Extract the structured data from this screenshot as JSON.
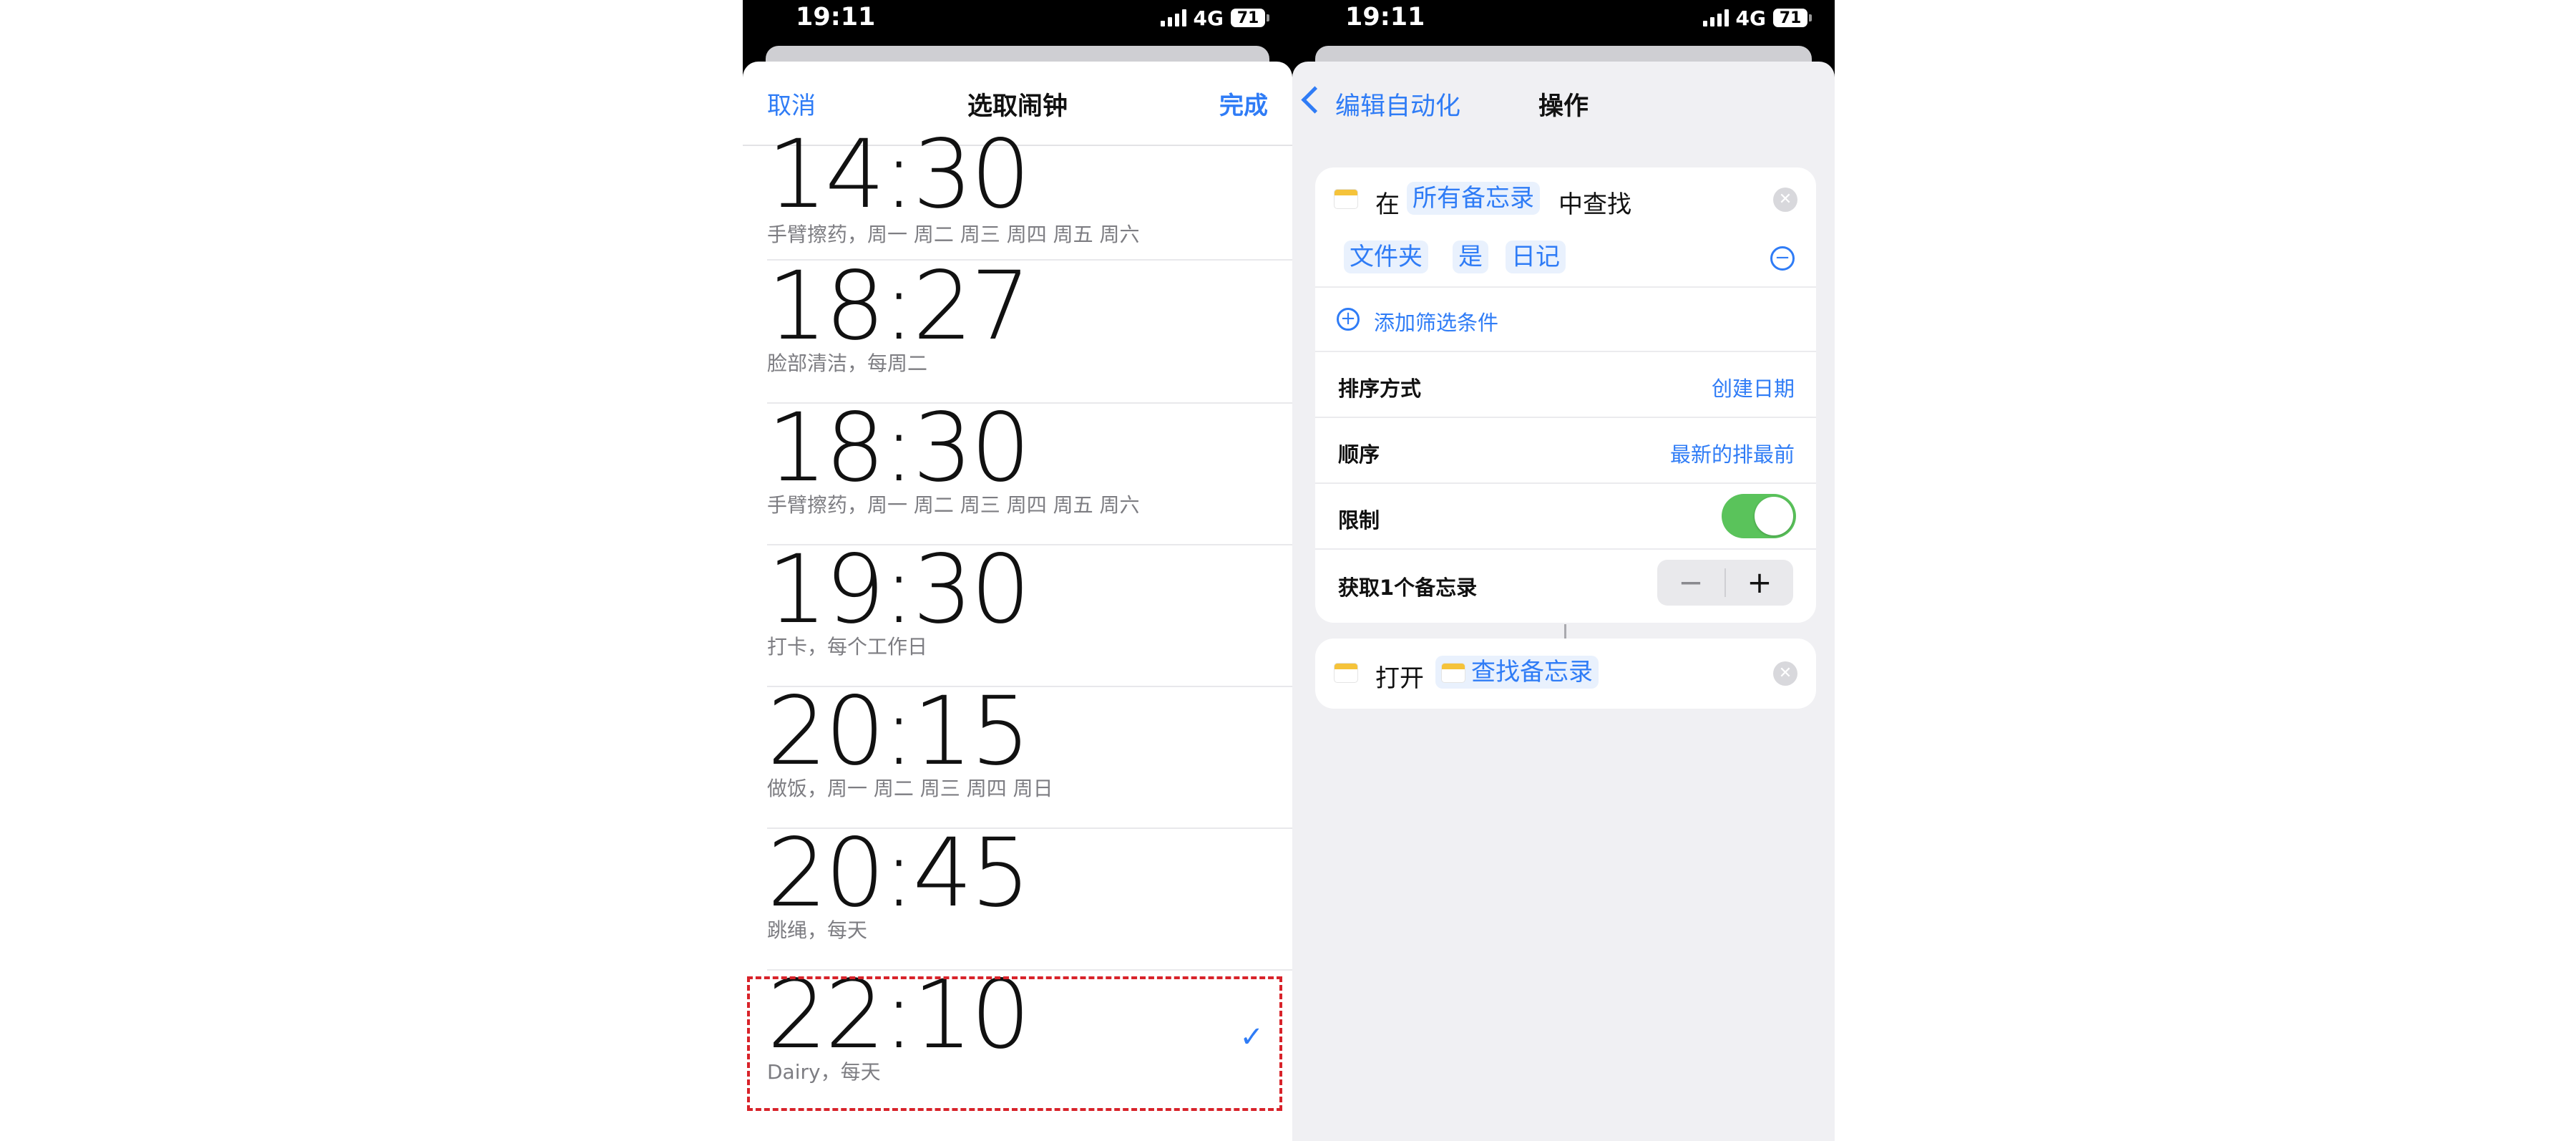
{
  "left": {
    "status": {
      "time": "19:11",
      "network": "4G",
      "battery": "71"
    },
    "nav": {
      "cancel": "取消",
      "title": "选取闹钟",
      "done": "完成"
    },
    "alarms": [
      {
        "time": "14:30",
        "label": "手臂擦药，周一 周二 周三 周四 周五 周六"
      },
      {
        "time": "18:27",
        "label": "脸部清洁，每周二"
      },
      {
        "time": "18:30",
        "label": "手臂擦药，周一 周二 周三 周四 周五 周六"
      },
      {
        "time": "19:30",
        "label": "打卡，每个工作日"
      },
      {
        "time": "20:15",
        "label": "做饭，周一 周二 周三 周四 周日"
      },
      {
        "time": "20:45",
        "label": "跳绳，每天"
      },
      {
        "time": "22:10",
        "label": "Dairy，每天",
        "selected": true
      }
    ],
    "checkmark": "✓"
  },
  "right": {
    "status": {
      "time": "19:11",
      "network": "4G",
      "battery": "71"
    },
    "nav": {
      "back": "编辑自动化",
      "title": "操作"
    },
    "find_action": {
      "prefix": "在",
      "source": "所有备忘录",
      "suffix": "中查找",
      "filter": {
        "field": "文件夹",
        "op": "是",
        "value": "日记"
      },
      "add_filter": "添加筛选条件",
      "sort_label": "排序方式",
      "sort_value": "创建日期",
      "order_label": "顺序",
      "order_value": "最新的排最前",
      "limit_label": "限制",
      "limit_enabled": true,
      "get_label": "获取1个备忘录",
      "stepper_minus": "−",
      "stepper_plus": "+"
    },
    "open_action": {
      "verb": "打开",
      "target": "查找备忘录"
    },
    "icons": {
      "note": "notes-app-icon",
      "clear": "clear-icon",
      "remove_filter": "minus-circle-icon",
      "add": "plus-circle-icon"
    },
    "colors": {
      "accent": "#2f7cf6",
      "toggle_on": "#5ac35b",
      "highlight": "#d8232a"
    }
  }
}
